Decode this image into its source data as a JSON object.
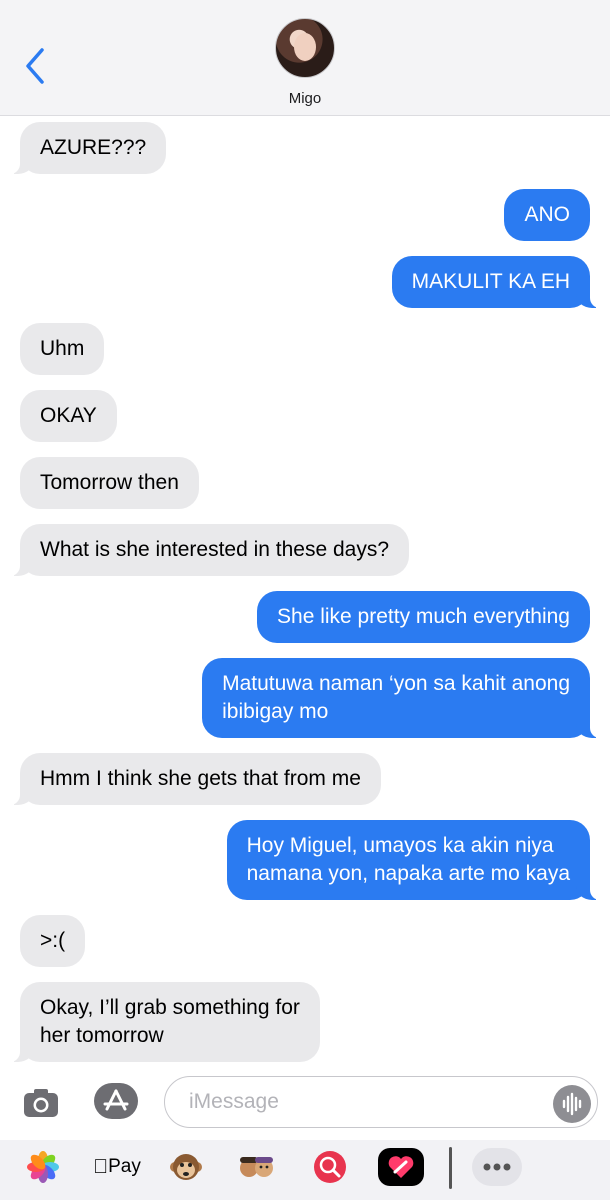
{
  "header": {
    "back_icon": "chevron-left-icon",
    "contact_name": "Migo"
  },
  "messages": [
    {
      "text": "AZURE???",
      "direction": "incoming"
    },
    {
      "text": "ANO",
      "direction": "outgoing"
    },
    {
      "text": "MAKULIT KA EH",
      "direction": "outgoing"
    },
    {
      "text": "Uhm",
      "direction": "incoming"
    },
    {
      "text": "OKAY",
      "direction": "incoming"
    },
    {
      "text": "Tomorrow then",
      "direction": "incoming"
    },
    {
      "text": "What is she interested in these days?",
      "direction": "incoming"
    },
    {
      "text": "She like pretty much everything",
      "direction": "outgoing"
    },
    {
      "text": "Matutuwa naman ‘yon sa kahit anong\nibibigay mo",
      "direction": "outgoing"
    },
    {
      "text": "Hmm I think she gets that from me",
      "direction": "incoming"
    },
    {
      "text": "Hoy Miguel, umayos ka akin niya\nnamana yon, napaka arte mo kaya",
      "direction": "outgoing"
    },
    {
      "text": ">:(",
      "direction": "incoming"
    },
    {
      "text": "Okay, I’ll grab something for\nher tomorrow",
      "direction": "incoming"
    }
  ],
  "composer": {
    "placeholder": "iMessage",
    "camera_icon": "camera-icon",
    "appstore_icon": "app-store-icon",
    "audio_icon": "audio-waveform-icon"
  },
  "app_strip": {
    "apple_pay_label": "Pay",
    "icons": [
      "photos-icon",
      "apple-pay-icon",
      "monkey-memoji-icon",
      "memoji-stickers-icon",
      "search-images-icon",
      "digital-touch-icon",
      "more-icon"
    ]
  },
  "colors": {
    "outgoing_bubble": "#2b7bf1",
    "incoming_bubble": "#e9e9eb",
    "accent": "#2b7bf1"
  }
}
